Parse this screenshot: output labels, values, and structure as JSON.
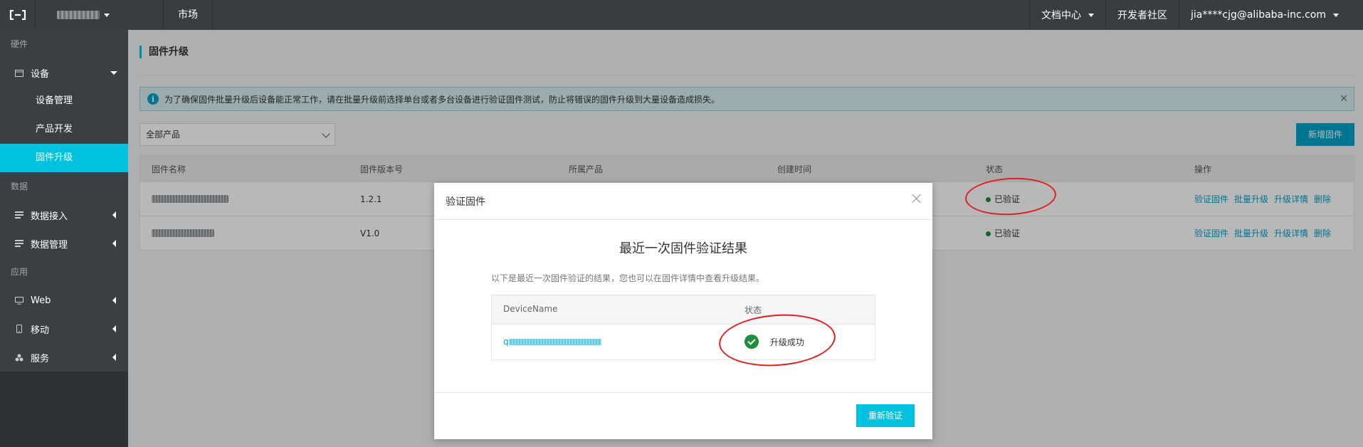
{
  "topbar": {
    "market": "市场",
    "docs": "文档中心",
    "devcommunity": "开发者社区",
    "user": "jia****cjg@alibaba-inc.com"
  },
  "sidebar": {
    "sec_hardware": "硬件",
    "device": "设备",
    "sub_device_mgmt": "设备管理",
    "sub_product_dev": "产品开发",
    "sub_firmware": "固件升级",
    "sec_data": "数据",
    "data_ingest": "数据接入",
    "data_mgmt": "数据管理",
    "sec_app": "应用",
    "web": "Web",
    "mobile": "移动",
    "service": "服务"
  },
  "main": {
    "title": "固件升级",
    "alert": "为了确保固件批量升级后设备能正常工作，请在批量升级前选择单台或者多台设备进行验证固件测试，防止将错误的固件升级到大量设备造成损失。",
    "select_value": "全部产品",
    "add_button": "新增固件",
    "columns": [
      "固件名称",
      "固件版本号",
      "所属产品",
      "创建时间",
      "状态",
      "操作"
    ],
    "rows": [
      {
        "version": "1.2.1",
        "status": "已验证"
      },
      {
        "version": "V1.0",
        "status": "已验证"
      }
    ],
    "actions": [
      "验证固件",
      "批量升级",
      "升级详情",
      "删除"
    ]
  },
  "modal": {
    "header": "验证固件",
    "title": "最近一次固件验证结果",
    "desc": "以下是最近一次固件验证的结果，您也可以在固件详情中查看升级结果。",
    "col_device": "DeviceName",
    "col_status": "状态",
    "device_prefix": "q",
    "result": "升级成功",
    "reverify": "重新验证"
  },
  "colors": {
    "accent": "#00c1de",
    "topbar": "#373d41",
    "sidebar": "#3a3f44",
    "success": "#1e8e3e",
    "annotation": "#e02020"
  }
}
